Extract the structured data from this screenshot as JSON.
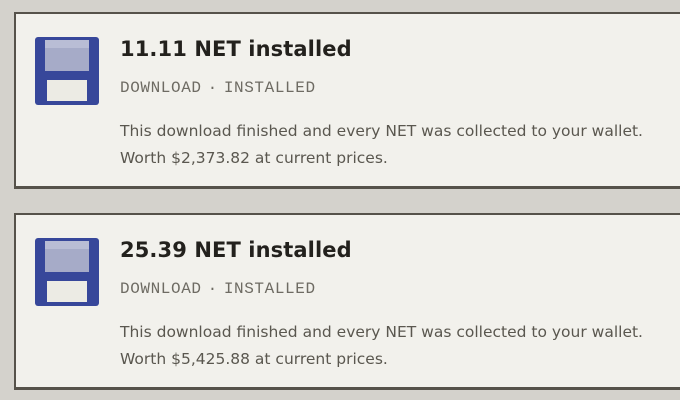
{
  "notifications": [
    {
      "title": "11.11 NET installed",
      "category": "DOWNLOAD",
      "separator": "·",
      "status": "INSTALLED",
      "message_line1": "This download finished and every NET was collected to your wallet.",
      "message_line2": "Worth $2,373.82 at current prices.",
      "icon": "floppy-disk-icon"
    },
    {
      "title": "25.39 NET installed",
      "category": "DOWNLOAD",
      "separator": "·",
      "status": "INSTALLED",
      "message_line1": "This download finished and every NET was collected to your wallet.",
      "message_line2": "Worth $5,425.88 at current prices.",
      "icon": "floppy-disk-icon"
    }
  ],
  "colors": {
    "background": "#d4d2cc",
    "card": "#f2f1ec",
    "border": "#56524a",
    "disk_body": "#37479a",
    "disk_shutter": "#a6abc8",
    "disk_label": "#ecebe4"
  }
}
